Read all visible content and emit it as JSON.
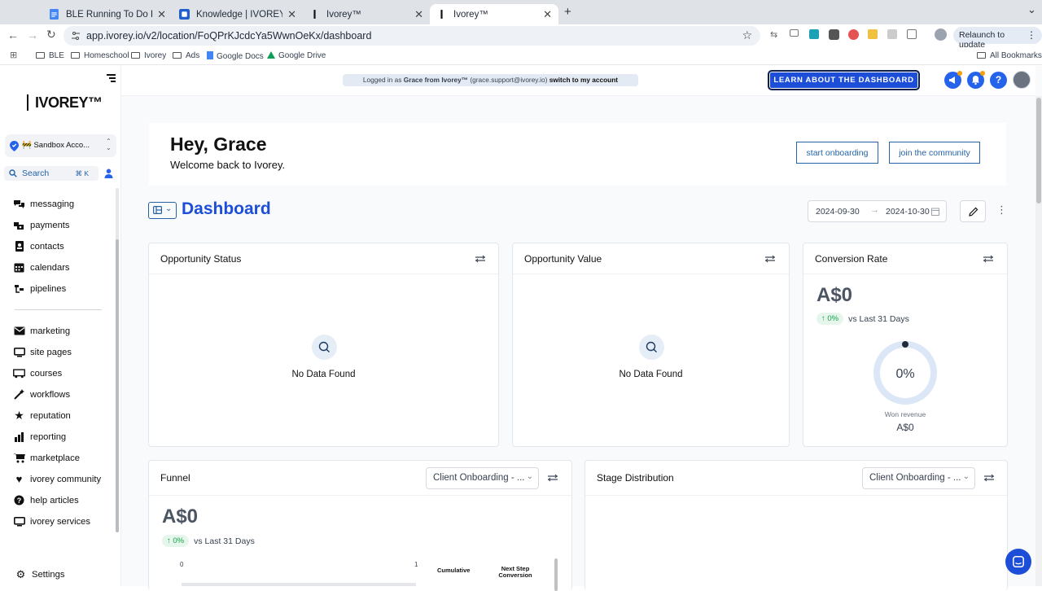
{
  "browser": {
    "tabs": [
      {
        "title": "BLE Running To Do List - Goo",
        "active": false
      },
      {
        "title": "Knowledge | IVOREY™ | Interc",
        "active": false
      },
      {
        "title": "Ivorey™",
        "active": false
      },
      {
        "title": "Ivorey™",
        "active": true
      }
    ],
    "url": "app.ivorey.io/v2/location/FoQPrKJcdcYa5WwnOeKx/dashboard",
    "relaunch_label": "Relaunch to update",
    "bookmarks": [
      "BLE",
      "Homeschool",
      "Ivorey",
      "Ads",
      "Google Docs",
      "Google Drive"
    ],
    "all_bookmarks": "All Bookmarks"
  },
  "sidebar": {
    "logo": "IVOREY™",
    "account": "🚧 Sandbox Acco...",
    "search_label": "Search",
    "search_shortcut": "⌘ K",
    "items_group1": [
      {
        "label": "messaging",
        "icon": "chat-icon"
      },
      {
        "label": "payments",
        "icon": "payments-icon"
      },
      {
        "label": "contacts",
        "icon": "contacts-icon"
      },
      {
        "label": "calendars",
        "icon": "calendar-icon"
      },
      {
        "label": "pipelines",
        "icon": "pipelines-icon"
      }
    ],
    "items_group2": [
      {
        "label": "marketing",
        "icon": "mail-icon"
      },
      {
        "label": "site pages",
        "icon": "monitor-icon"
      },
      {
        "label": "courses",
        "icon": "courses-icon"
      },
      {
        "label": "workflows",
        "icon": "workflows-icon"
      },
      {
        "label": "reputation",
        "icon": "star-icon"
      },
      {
        "label": "reporting",
        "icon": "reporting-icon"
      },
      {
        "label": "marketplace",
        "icon": "cart-icon"
      },
      {
        "label": "ivorey community",
        "icon": "heart-icon"
      },
      {
        "label": "help articles",
        "icon": "help-icon"
      },
      {
        "label": "ivorey services",
        "icon": "monitor-icon"
      }
    ],
    "settings_label": "Settings"
  },
  "topbar": {
    "logged_in_prefix": "Logged in as",
    "logged_in_name": "Grace from Ivorey™",
    "logged_in_email": "(grace.support@ivorey.io)",
    "switch_label": "switch to my account",
    "learn_button": "LEARN ABOUT THE DASHBOARD"
  },
  "welcome": {
    "greeting": "Hey, Grace",
    "subtitle": "Welcome back to Ivorey.",
    "start_onboarding": "start onboarding",
    "join_community": "join the community"
  },
  "dashboard": {
    "title": "Dashboard",
    "date_from": "2024-09-30",
    "date_to": "2024-10-30"
  },
  "cards": {
    "opportunity_status": {
      "title": "Opportunity Status",
      "empty": "No Data Found"
    },
    "opportunity_value": {
      "title": "Opportunity Value",
      "empty": "No Data Found"
    },
    "conversion_rate": {
      "title": "Conversion Rate",
      "value": "A$0",
      "change": "0%",
      "compare": "vs Last 31 Days",
      "gauge_label": "0%",
      "gauge_fraction": 0,
      "won_label": "Won revenue",
      "won_value": "A$0"
    },
    "funnel": {
      "title": "Funnel",
      "select": "Client Onboarding - ...",
      "value": "A$0",
      "change": "0%",
      "compare": "vs Last 31 Days",
      "axis_min": "0",
      "axis_max": "1",
      "col_cumulative": "Cumulative",
      "col_next_line1": "Next Step",
      "col_next_line2": "Conversion"
    },
    "stage_distribution": {
      "title": "Stage Distribution",
      "select": "Client Onboarding - ..."
    }
  },
  "colors": {
    "brand_blue": "#1d4ed8",
    "link_blue": "#2563a8",
    "gauge_ring": "#dbe6f6",
    "positive_green": "#16a34a"
  }
}
